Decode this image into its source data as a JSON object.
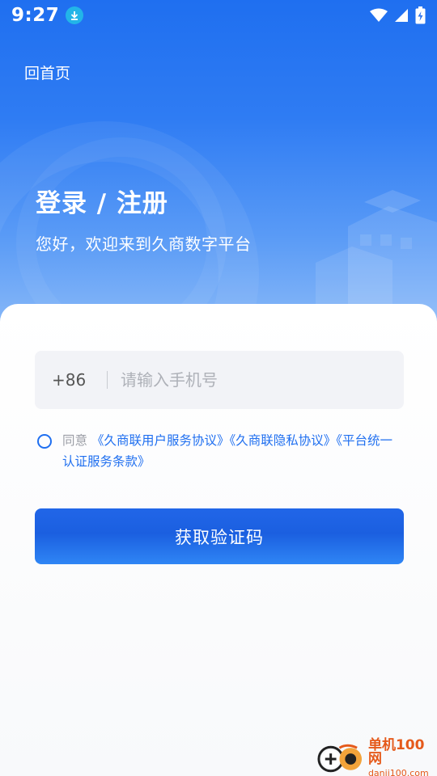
{
  "status_bar": {
    "time": "9:27"
  },
  "nav": {
    "home_label": "回首页"
  },
  "hero": {
    "title": "登录 / 注册",
    "subtitle": "您好，欢迎来到久商数字平台"
  },
  "form": {
    "country_code": "+86",
    "phone_value": "",
    "phone_placeholder": "请输入手机号",
    "agree_prefix": "同意",
    "agreement_links": [
      "《久商联用户服务协议》",
      "《久商联隐私协议》",
      "《平台统一认证服务条款》"
    ],
    "submit_label": "获取验证码"
  },
  "watermark": {
    "name": "单机100网",
    "url": "danji100.com"
  },
  "colors": {
    "primary": "#1f6ff0",
    "hero_top": "#1f6ff0",
    "hero_bottom": "#8ebcf8",
    "link": "#1f6ff0",
    "watermark": "#e55a1b"
  }
}
